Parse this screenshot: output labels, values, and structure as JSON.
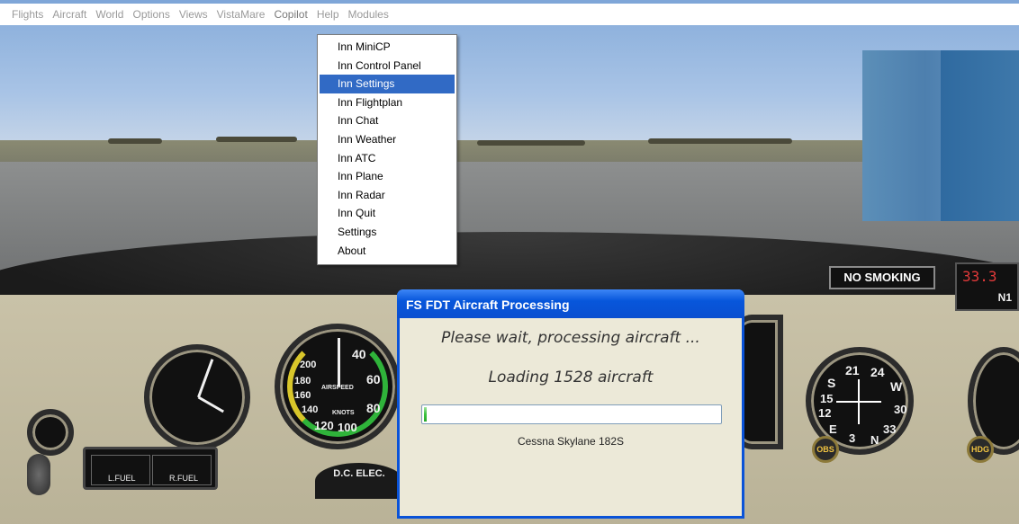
{
  "menubar": {
    "items": [
      "Flights",
      "Aircraft",
      "World",
      "Options",
      "Views",
      "VistaMare",
      "Copilot",
      "Help",
      "Modules"
    ]
  },
  "copilot_menu": {
    "items": [
      "Inn MiniCP",
      "Inn Control Panel",
      "Inn Settings",
      "Inn Flightplan",
      "Inn Chat",
      "Inn Weather",
      "Inn ATC",
      "Inn Plane",
      "Inn Radar",
      "Inn Quit",
      "Settings",
      "About"
    ],
    "highlighted": "Inn Settings"
  },
  "dialog": {
    "title": "FS FDT Aircraft Processing",
    "message": "Please wait, processing aircraft ...",
    "status": "Loading 1528 aircraft",
    "progress_fraction": 0.01,
    "current_item": "Cessna Skylane 182S"
  },
  "cockpit": {
    "placard": "NO SMOKING",
    "digital_value": "33.3",
    "digital_label": "N1",
    "airspeed_label": "KNOTS",
    "airspeed_sub": "AIRSPEED",
    "airspeed_marks": [
      "200",
      "40",
      "180",
      "60",
      "160",
      "80",
      "140",
      "120",
      "100"
    ],
    "fuel_left": "L.FUEL",
    "fuel_right": "R.FUEL",
    "elec_label": "D.C. ELEC.",
    "hdg_label": "HDG",
    "obs_label": "OBS",
    "compass_marks": [
      "S",
      "21",
      "24",
      "W",
      "30",
      "33",
      "N",
      "3",
      "E",
      "12",
      "15"
    ]
  },
  "colors": {
    "selection": "#316ac5",
    "dialog_title": "#0a53d8",
    "progress": "#3cc23e"
  }
}
